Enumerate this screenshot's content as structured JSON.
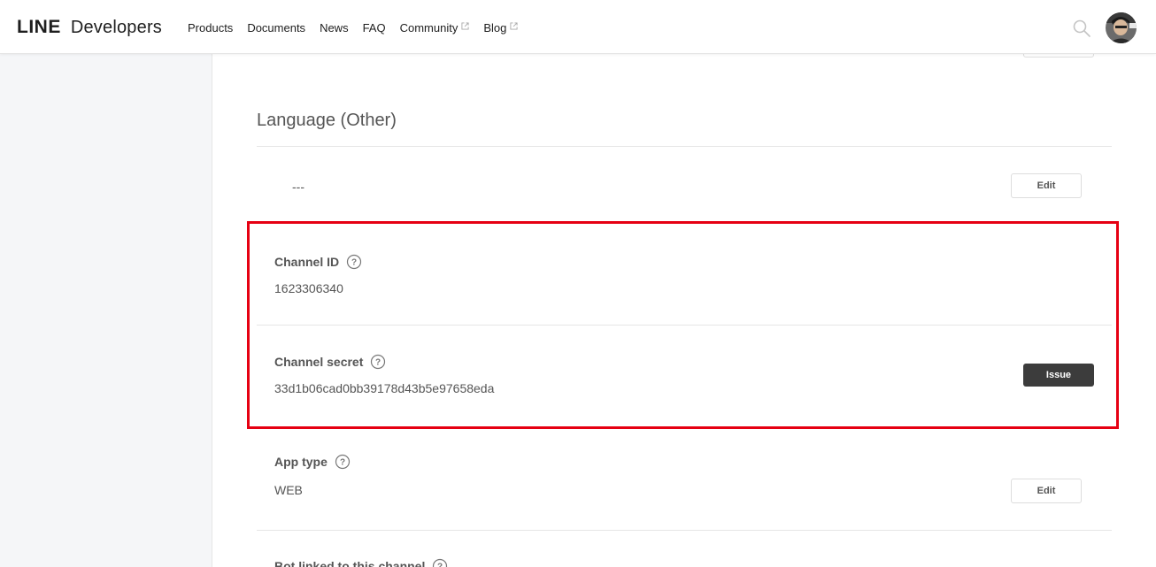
{
  "header": {
    "logo_line": "LINE",
    "logo_developers": "Developers",
    "nav": [
      {
        "label": "Products",
        "external": false
      },
      {
        "label": "Documents",
        "external": false
      },
      {
        "label": "News",
        "external": false
      },
      {
        "label": "FAQ",
        "external": false
      },
      {
        "label": "Community",
        "external": true
      },
      {
        "label": "Blog",
        "external": true
      }
    ]
  },
  "language_other": {
    "title": "Language (Other)",
    "value": "---",
    "edit_label": "Edit"
  },
  "channel_id": {
    "label": "Channel ID",
    "value": "1623306340"
  },
  "channel_secret": {
    "label": "Channel secret",
    "value": "33d1b06cad0bb39178d43b5e97658eda",
    "issue_label": "Issue"
  },
  "app_type": {
    "label": "App type",
    "value": "WEB",
    "edit_label": "Edit"
  },
  "bot_linked": {
    "label": "Bot linked to this channel"
  },
  "colors": {
    "highlight": "#e60012",
    "dark_button": "#3c3c3c",
    "sidebar_bg": "#f5f6f8"
  }
}
